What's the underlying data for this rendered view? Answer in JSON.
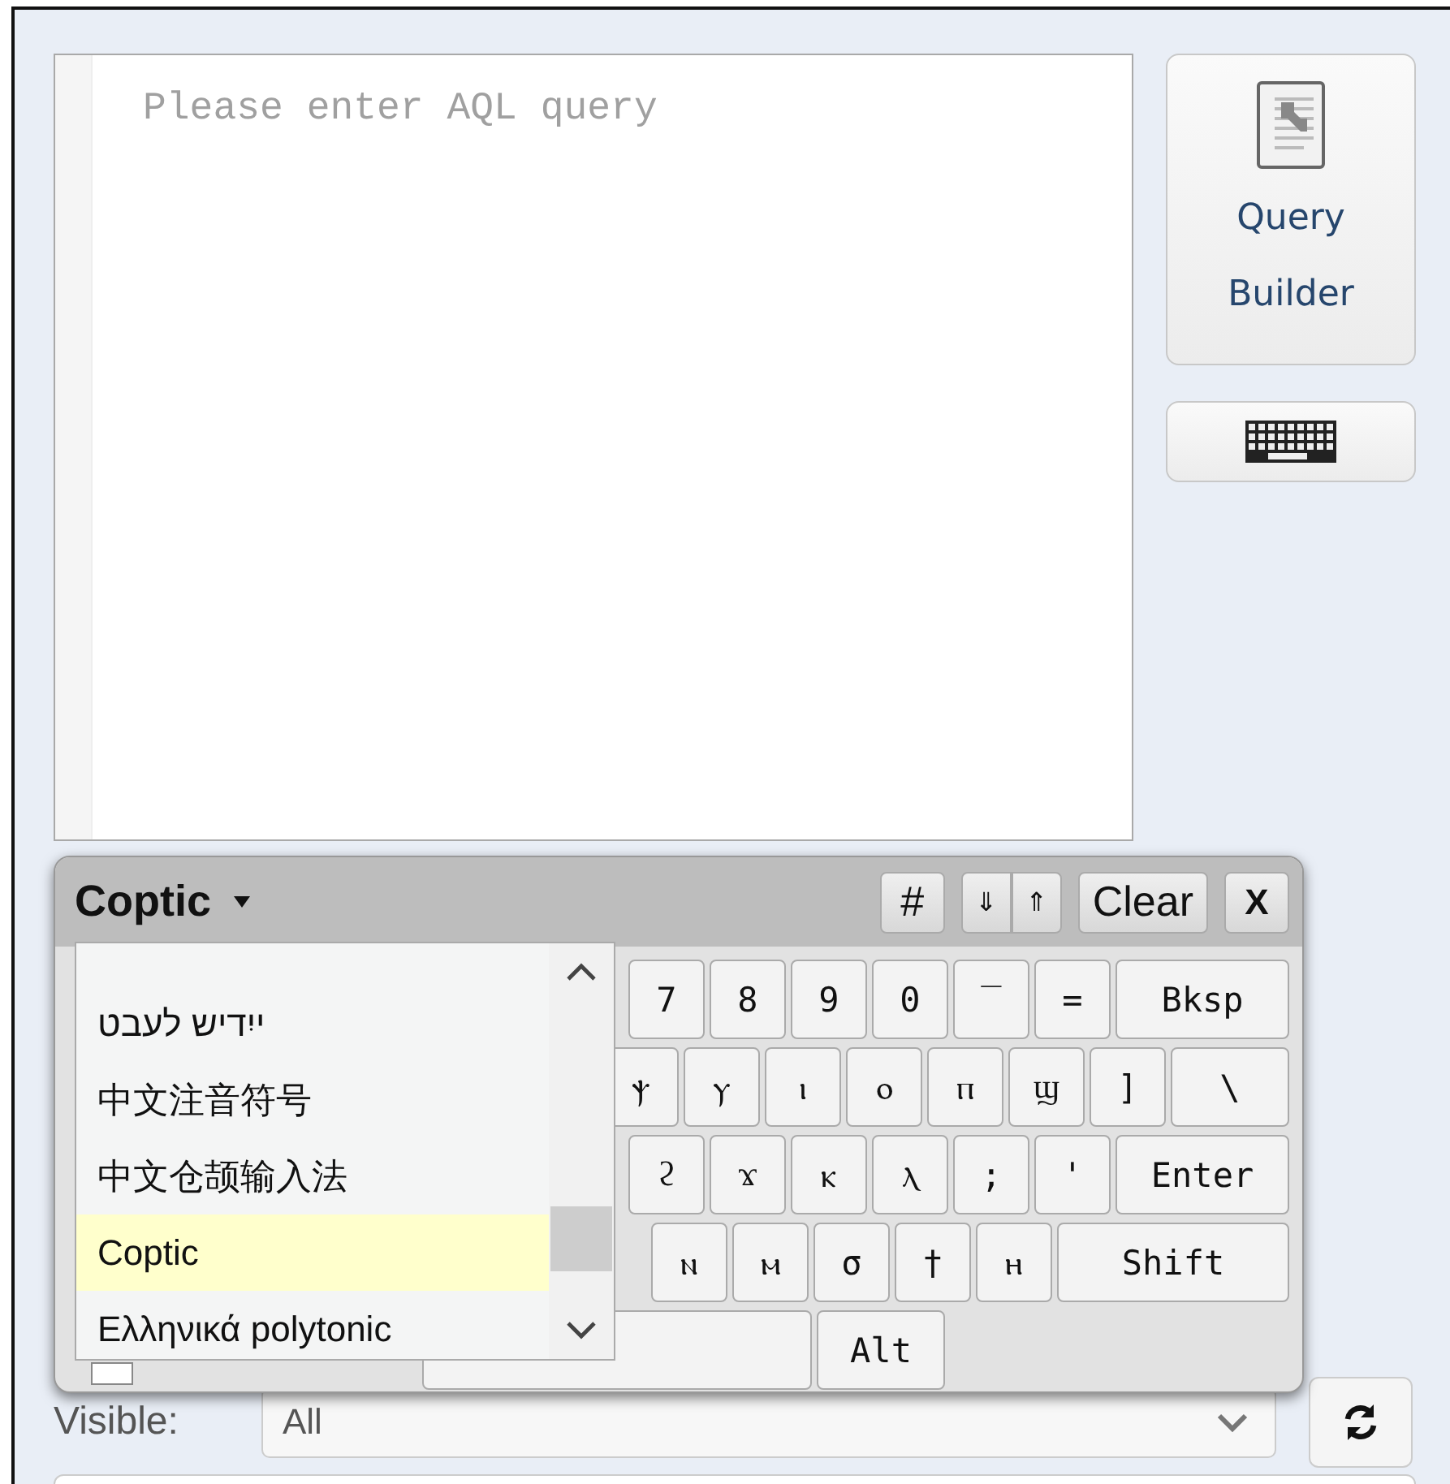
{
  "editor": {
    "placeholder": "Please enter AQL query"
  },
  "side_buttons": [
    {
      "kind": "query-builder",
      "label": "Query Builder"
    },
    {
      "kind": "keyboard"
    }
  ],
  "keyboard": {
    "layout": "Coptic",
    "controls": [
      {
        "kind": "plain",
        "label": "#"
      },
      {
        "kind": "joined-left",
        "label": "⇓"
      },
      {
        "kind": "joined-right",
        "label": "⇑"
      },
      {
        "kind": "plain",
        "label": "Clear"
      },
      {
        "kind": "close",
        "label": "X"
      }
    ],
    "rows": [
      {
        "kind": "right",
        "keys": [
          {
            "kind": "key",
            "label": "7"
          },
          {
            "kind": "key",
            "label": "8"
          },
          {
            "kind": "key",
            "label": "9"
          },
          {
            "kind": "key",
            "label": "0"
          },
          {
            "kind": "key",
            "label": "‾"
          },
          {
            "kind": "key",
            "label": "="
          },
          {
            "kind": "wide",
            "label": "Bksp"
          }
        ]
      },
      {
        "kind": "right",
        "keys": [
          {
            "kind": "key",
            "label": "ⲯ"
          },
          {
            "kind": "key",
            "label": "ⲩ"
          },
          {
            "kind": "key",
            "label": "ⲓ"
          },
          {
            "kind": "key",
            "label": "ⲟ"
          },
          {
            "kind": "key",
            "label": "ⲡ"
          },
          {
            "kind": "key",
            "label": "ϣ"
          },
          {
            "kind": "key",
            "label": "]"
          },
          {
            "kind": "mid",
            "label": "\\"
          }
        ]
      },
      {
        "kind": "right",
        "keys": [
          {
            "kind": "key",
            "label": "ϩ"
          },
          {
            "kind": "key",
            "label": "ϫ"
          },
          {
            "kind": "key",
            "label": "ⲕ"
          },
          {
            "kind": "key",
            "label": "ⲗ"
          },
          {
            "kind": "key",
            "label": ";"
          },
          {
            "kind": "key",
            "label": "'"
          },
          {
            "kind": "wide",
            "label": "Enter"
          }
        ]
      },
      {
        "kind": "right",
        "keys": [
          {
            "kind": "key",
            "label": "ⲛ"
          },
          {
            "kind": "key",
            "label": "ⲙ"
          },
          {
            "kind": "key",
            "label": "σ"
          },
          {
            "kind": "key",
            "label": "†"
          },
          {
            "kind": "key",
            "label": "ⲏ"
          },
          {
            "kind": "shift",
            "label": "Shift"
          }
        ]
      },
      {
        "kind": "bottom",
        "keys": [
          {
            "kind": "space"
          },
          {
            "kind": "alt",
            "label": "Alt"
          }
        ]
      }
    ],
    "layout_menu": {
      "items": [
        {
          "label": "ייִדיש לעבט",
          "selected": false
        },
        {
          "label": "中文注音符号",
          "selected": false
        },
        {
          "label": "中文仓颉输入法",
          "selected": false
        },
        {
          "label": "Coptic",
          "selected": true
        },
        {
          "label": "Ελληνικά polytonic",
          "selected": false
        }
      ]
    }
  },
  "checkbox": {
    "checked": false
  },
  "visible_filter": {
    "label": "Visible:",
    "value": "All"
  }
}
